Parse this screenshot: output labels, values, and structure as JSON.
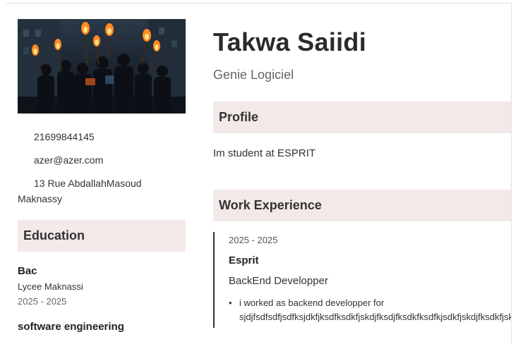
{
  "profile": {
    "name": "Takwa Saiidi",
    "title": "Genie Logiciel",
    "photo_icon": "photo-torches-crowd"
  },
  "contact": {
    "phone": "21699844145",
    "email": "azer@azer.com",
    "address_line1": "13 Rue AbdallahMasoud",
    "address_line2": "Maknassy"
  },
  "education": {
    "heading": "Education",
    "items": [
      {
        "degree": "Bac",
        "school": "Lycee Maknassi",
        "dates": "2025 - 2025"
      },
      {
        "degree": "software engineering"
      }
    ]
  },
  "sections": {
    "profile_heading": "Profile",
    "profile_text": "Im student at ESPRIT",
    "work_heading": "Work Experience"
  },
  "work": [
    {
      "dates": "2025 - 2025",
      "company": "Esprit",
      "role": "BackEnd Developper",
      "bullet_line1": "i worked as backend developper for",
      "bullet_line2": "sjdjfsdfsdfjsdfksjdkfjksdfksdkfjskdjfksdjfksdkfksdfkjsdkfjskdjfksdkfjskd"
    }
  ],
  "colors": {
    "section_bg": "#f3e9e8",
    "text_dark": "#2b2b2b",
    "text_muted": "#666666"
  }
}
